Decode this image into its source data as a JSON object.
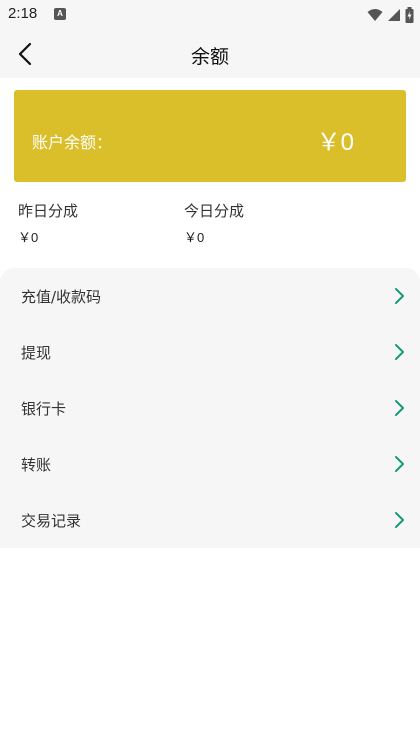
{
  "status": {
    "time": "2:18",
    "notification_letter": "A"
  },
  "header": {
    "title": "余额"
  },
  "balance": {
    "label": "账户余额：",
    "value": "￥0"
  },
  "stats": {
    "yesterday_label": "昨日分成",
    "yesterday_value": "￥0",
    "today_label": "今日分成",
    "today_value": "￥0"
  },
  "menu": {
    "items": [
      {
        "label": "充值/收款码"
      },
      {
        "label": "提现"
      },
      {
        "label": "银行卡"
      },
      {
        "label": "转账"
      },
      {
        "label": "交易记录"
      }
    ]
  },
  "colors": {
    "card": "#dabf2a",
    "chevron": "#1a9a78",
    "panel": "#f6f6f6"
  }
}
